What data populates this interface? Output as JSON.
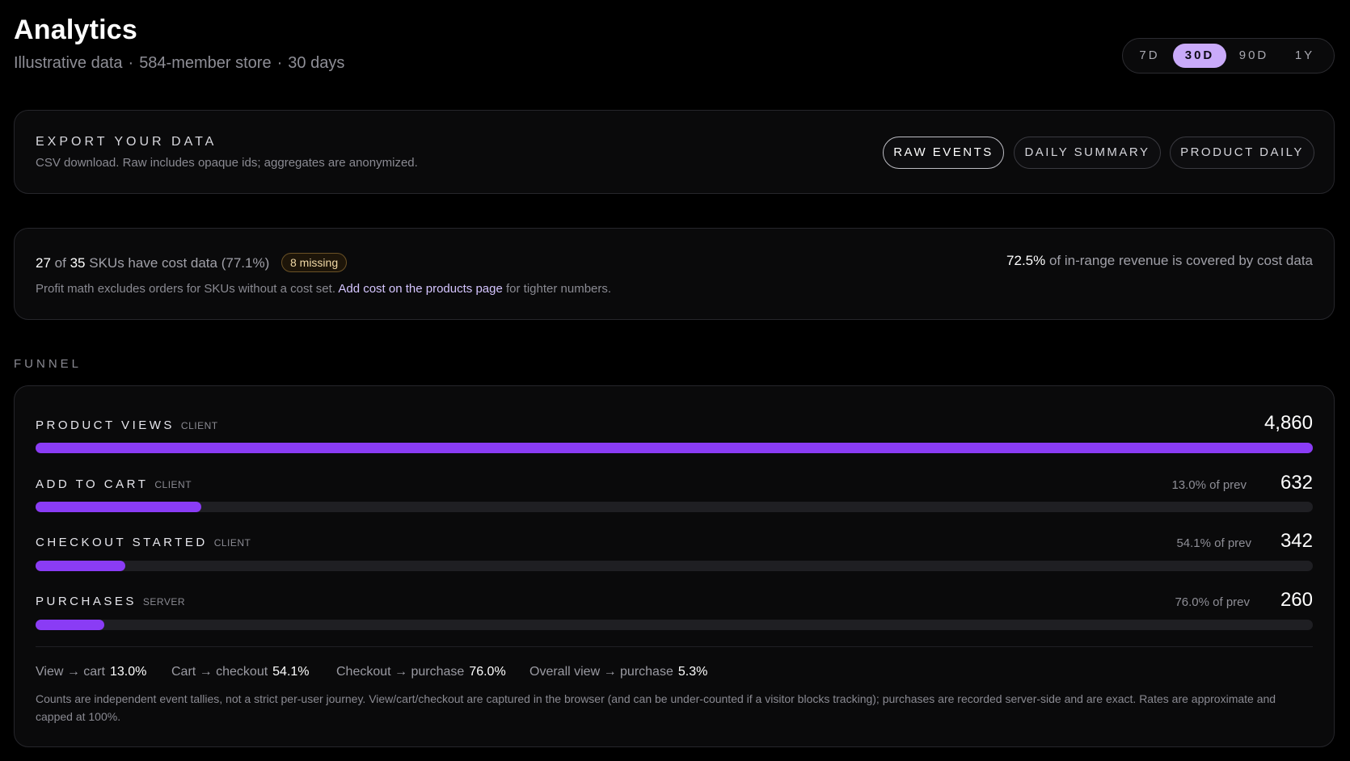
{
  "header": {
    "title": "Analytics",
    "subtitle_parts": [
      "Illustrative data",
      "584-member store",
      "30 days"
    ],
    "separator": "·"
  },
  "range_selector": {
    "options": [
      "7D",
      "30D",
      "90D",
      "1Y"
    ],
    "selected": "30D"
  },
  "export": {
    "heading": "EXPORT YOUR DATA",
    "description": "CSV download. Raw includes opaque ids; aggregates are anonymized.",
    "buttons": [
      "RAW EVENTS",
      "DAILY SUMMARY",
      "PRODUCT DAILY"
    ]
  },
  "cost_coverage": {
    "skus_with_cost": "27",
    "of_word": "of",
    "skus_total": "35",
    "skus_text": "SKUs have cost data (77.1%)",
    "missing_badge": "8 missing",
    "note_before": "Profit math excludes orders for SKUs without a cost set.",
    "link": "Add cost on the products page",
    "note_after": "for tighter numbers.",
    "revenue_pct": "72.5%",
    "revenue_text": "of in-range revenue is covered by cost data"
  },
  "funnel": {
    "section_label": "FUNNEL",
    "stages": [
      {
        "name": "PRODUCT VIEWS",
        "source": "CLIENT",
        "count": "4,860",
        "value": 4860,
        "rate": ""
      },
      {
        "name": "ADD TO CART",
        "source": "CLIENT",
        "count": "632",
        "value": 632,
        "rate": "13.0% of prev"
      },
      {
        "name": "CHECKOUT STARTED",
        "source": "CLIENT",
        "count": "342",
        "value": 342,
        "rate": "54.1% of prev"
      },
      {
        "name": "PURCHASES",
        "source": "SERVER",
        "count": "260",
        "value": 260,
        "rate": "76.0% of prev"
      }
    ],
    "conversions": [
      {
        "label": "View → cart",
        "value": "13.0%"
      },
      {
        "label": "Cart → checkout",
        "value": "54.1%"
      },
      {
        "label": "Checkout → purchase",
        "value": "76.0%"
      },
      {
        "label": "Overall view → purchase",
        "value": "5.3%"
      }
    ],
    "footnote": "Counts are independent event tallies, not a strict per-user journey. View/cart/checkout are captured in the browser (and can be under-counted if a visitor blocks tracking); purchases are recorded server-side and are exact. Rates are approximate and capped at 100%."
  },
  "colors": {
    "accent": "#8a3cf5",
    "selected_range": "#c9aaf9",
    "warning_badge": "#f1d9a6"
  }
}
